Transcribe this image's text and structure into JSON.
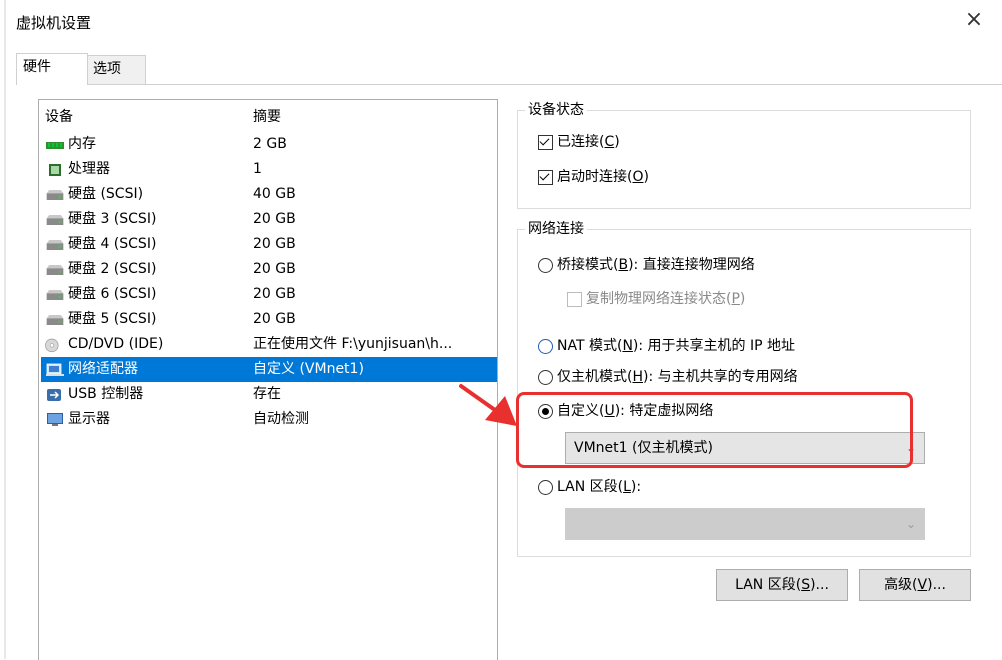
{
  "window": {
    "title": "虚拟机设置",
    "close_glyph": "×"
  },
  "tabs": [
    {
      "label": "硬件",
      "active": true
    },
    {
      "label": "选项",
      "active": false
    }
  ],
  "device_list": {
    "headers": {
      "device": "设备",
      "summary": "摘要"
    },
    "items": [
      {
        "icon": "memory-icon",
        "name": "内存",
        "summary": "2 GB"
      },
      {
        "icon": "processor-icon",
        "name": "处理器",
        "summary": "1"
      },
      {
        "icon": "harddisk-icon",
        "name": "硬盘 (SCSI)",
        "summary": "40 GB"
      },
      {
        "icon": "harddisk-icon",
        "name": "硬盘 3 (SCSI)",
        "summary": "20 GB"
      },
      {
        "icon": "harddisk-icon",
        "name": "硬盘 4 (SCSI)",
        "summary": "20 GB"
      },
      {
        "icon": "harddisk-icon",
        "name": "硬盘 2 (SCSI)",
        "summary": "20 GB"
      },
      {
        "icon": "harddisk-icon",
        "name": "硬盘 6 (SCSI)",
        "summary": "20 GB"
      },
      {
        "icon": "harddisk-icon",
        "name": "硬盘 5 (SCSI)",
        "summary": "20 GB"
      },
      {
        "icon": "cd-icon",
        "name": "CD/DVD (IDE)",
        "summary": "正在使用文件 F:\\yunjisuan\\h..."
      },
      {
        "icon": "network-adapter-icon",
        "name": "网络适配器",
        "summary": "自定义 (VMnet1)",
        "selected": true
      },
      {
        "icon": "usb-icon",
        "name": "USB 控制器",
        "summary": "存在"
      },
      {
        "icon": "display-icon",
        "name": "显示器",
        "summary": "自动检测"
      }
    ]
  },
  "device_status": {
    "title": "设备状态",
    "connected": {
      "label": "已连接(",
      "key": "C",
      "suffix": ")",
      "checked": true
    },
    "connect_at_power_on": {
      "label": "启动时连接(",
      "key": "O",
      "suffix": ")",
      "checked": true
    }
  },
  "network_connection": {
    "title": "网络连接",
    "bridged": {
      "label": "桥接模式(",
      "key": "B",
      "suffix": "): 直接连接物理网络",
      "checked": false
    },
    "replicate": {
      "label": "复制物理网络连接状态(",
      "key": "P",
      "suffix": ")",
      "checked": false
    },
    "nat": {
      "label": "NAT 模式(",
      "key": "N",
      "suffix": "): 用于共享主机的 IP 地址",
      "checked": false
    },
    "host_only": {
      "label": "仅主机模式(",
      "key": "H",
      "suffix": "): 与主机共享的专用网络",
      "checked": false
    },
    "custom": {
      "label": "自定义(",
      "key": "U",
      "suffix": "): 特定虚拟网络",
      "checked": true
    },
    "custom_select_value": "VMnet1 (仅主机模式)",
    "lan_segment": {
      "label": "LAN 区段(",
      "key": "L",
      "suffix": "):",
      "checked": false
    },
    "lan_select_value": ""
  },
  "buttons": {
    "lan_segments": {
      "label": "LAN 区段(",
      "key": "S",
      "suffix": ")..."
    },
    "advanced": {
      "label": "高级(",
      "key": "V",
      "suffix": ")..."
    }
  },
  "colors": {
    "selection": "#0078d7",
    "highlight_box": "#e8312e",
    "arrow": "#e8312e"
  }
}
